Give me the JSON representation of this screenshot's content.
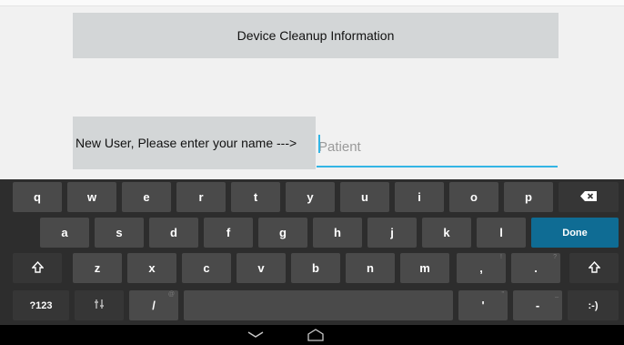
{
  "form": {
    "title": "Device Cleanup Information",
    "name_label": "New User, Please enter your name --->",
    "name_placeholder": "Patient"
  },
  "keyboard": {
    "row1": [
      "q",
      "w",
      "e",
      "r",
      "t",
      "y",
      "u",
      "i",
      "o",
      "p"
    ],
    "row2": [
      "a",
      "s",
      "d",
      "f",
      "g",
      "h",
      "j",
      "k",
      "l"
    ],
    "row3": [
      "z",
      "x",
      "c",
      "v",
      "b",
      "n",
      "m"
    ],
    "done_label": "Done",
    "symbols_label": "?123",
    "slash_label": "/",
    "at_hint": "@",
    "comma_label": ",",
    "comma_hint": "!",
    "period_label": ".",
    "period_hint": "?",
    "apostrophe_label": "'",
    "apostrophe_hint": "\"",
    "dash_label": "-",
    "dash_hint": "_",
    "smiley_label": ":-)",
    "icons": {
      "backspace": "backspace-icon",
      "shift": "shift-icon",
      "settings": "settings-icon"
    }
  },
  "colors": {
    "accent": "#33b5e5",
    "done_key": "#0f6c94",
    "key": "#4a4a4a",
    "keyboard_bg": "#2d2d2d"
  },
  "navbar": {
    "icons": [
      "back-chevron-icon",
      "home-icon"
    ]
  }
}
